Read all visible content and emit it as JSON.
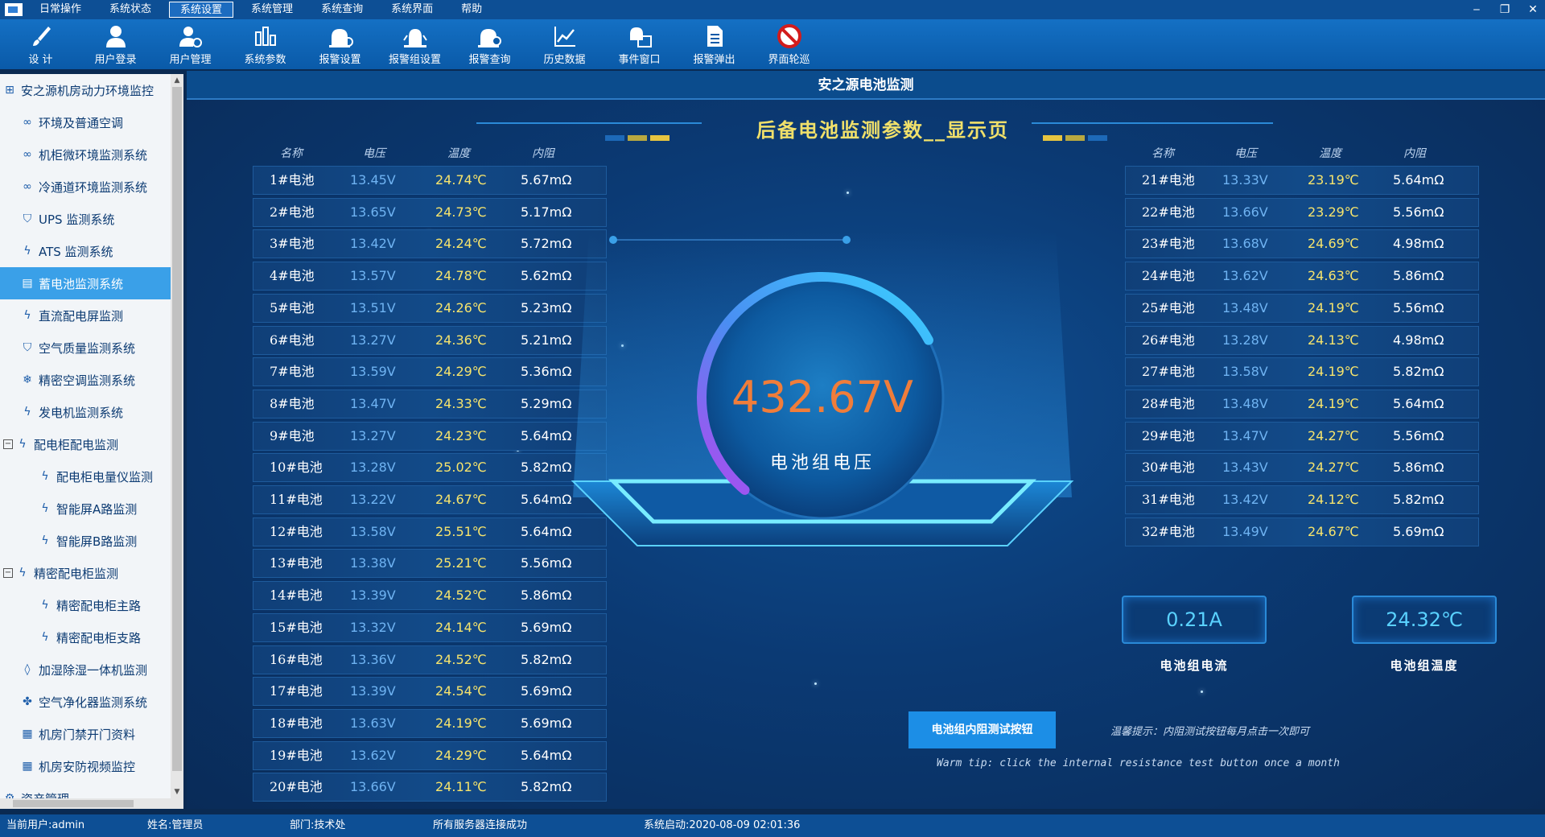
{
  "menubar": {
    "items": [
      "日常操作",
      "系统状态",
      "系统设置",
      "系统管理",
      "系统查询",
      "系统界面",
      "帮助"
    ],
    "active_index": 2,
    "window_controls": [
      "‒",
      "❐",
      "✕"
    ]
  },
  "toolbar": {
    "items": [
      {
        "label": "设 计",
        "icon": "brush-icon"
      },
      {
        "label": "用户登录",
        "icon": "user-icon"
      },
      {
        "label": "用户管理",
        "icon": "user-settings-icon"
      },
      {
        "label": "系统参数",
        "icon": "bar-chart-icon"
      },
      {
        "label": "报警设置",
        "icon": "alarm-settings-icon"
      },
      {
        "label": "报警组设置",
        "icon": "alarm-group-icon"
      },
      {
        "label": "报警查询",
        "icon": "alarm-search-icon"
      },
      {
        "label": "历史数据",
        "icon": "line-chart-icon"
      },
      {
        "label": "事件窗口",
        "icon": "event-window-icon"
      },
      {
        "label": "报警弹出",
        "icon": "document-icon"
      },
      {
        "label": "界面轮巡",
        "icon": "no-entry-icon"
      }
    ]
  },
  "sidebar": {
    "items": [
      {
        "label": "安之源机房动力环境监控",
        "icon": "grid-icon",
        "indent": 0,
        "expander": ""
      },
      {
        "label": "环境及普通空调",
        "icon": "link-icon",
        "indent": 1,
        "expander": ""
      },
      {
        "label": "机柜微环境监测系统",
        "icon": "link-icon",
        "indent": 1,
        "expander": ""
      },
      {
        "label": "冷通道环境监测系统",
        "icon": "link-icon",
        "indent": 1,
        "expander": ""
      },
      {
        "label": "UPS 监测系统",
        "icon": "shield-icon",
        "indent": 1,
        "expander": ""
      },
      {
        "label": "ATS 监测系统",
        "icon": "bolt-icon",
        "indent": 1,
        "expander": ""
      },
      {
        "label": "蓄电池监测系统",
        "icon": "battery-icon",
        "indent": 1,
        "expander": "",
        "selected": true
      },
      {
        "label": "直流配电屏监测",
        "icon": "bolt-icon",
        "indent": 1,
        "expander": ""
      },
      {
        "label": "空气质量监测系统",
        "icon": "shield-icon",
        "indent": 1,
        "expander": ""
      },
      {
        "label": "精密空调监测系统",
        "icon": "snowflake-icon",
        "indent": 1,
        "expander": ""
      },
      {
        "label": "发电机监测系统",
        "icon": "bolt-icon",
        "indent": 1,
        "expander": ""
      },
      {
        "label": "配电柜配电监测",
        "icon": "bolt-icon",
        "indent": 0,
        "expander": "−"
      },
      {
        "label": "配电柜电量仪监测",
        "icon": "bolt-icon",
        "indent": 2,
        "expander": ""
      },
      {
        "label": "智能屏A路监测",
        "icon": "bolt-icon",
        "indent": 2,
        "expander": ""
      },
      {
        "label": "智能屏B路监测",
        "icon": "bolt-icon",
        "indent": 2,
        "expander": ""
      },
      {
        "label": "精密配电柜监测",
        "icon": "bolt-icon",
        "indent": 0,
        "expander": "−"
      },
      {
        "label": "精密配电柜主路",
        "icon": "bolt-icon",
        "indent": 2,
        "expander": ""
      },
      {
        "label": "精密配电柜支路",
        "icon": "bolt-icon",
        "indent": 2,
        "expander": ""
      },
      {
        "label": "加湿除湿一体机监测",
        "icon": "droplet-icon",
        "indent": 1,
        "expander": ""
      },
      {
        "label": "空气净化器监测系统",
        "icon": "fan-icon",
        "indent": 1,
        "expander": ""
      },
      {
        "label": "机房门禁开门资料",
        "icon": "list-icon",
        "indent": 1,
        "expander": ""
      },
      {
        "label": "机房安防视频监控",
        "icon": "list-icon",
        "indent": 1,
        "expander": ""
      },
      {
        "label": "资产管理",
        "icon": "gear-icon",
        "indent": 0,
        "expander": ""
      }
    ]
  },
  "main": {
    "window_title": "安之源电池监测",
    "banner": "后备电池监测参数__显示页",
    "columns": [
      "名称",
      "电压",
      "温度",
      "内阻"
    ],
    "left_batteries": [
      [
        "1#电池",
        "13.45V",
        "24.74℃",
        "5.67mΩ"
      ],
      [
        "2#电池",
        "13.65V",
        "24.73℃",
        "5.17mΩ"
      ],
      [
        "3#电池",
        "13.42V",
        "24.24℃",
        "5.72mΩ"
      ],
      [
        "4#电池",
        "13.57V",
        "24.78℃",
        "5.62mΩ"
      ],
      [
        "5#电池",
        "13.51V",
        "24.26℃",
        "5.23mΩ"
      ],
      [
        "6#电池",
        "13.27V",
        "24.36℃",
        "5.21mΩ"
      ],
      [
        "7#电池",
        "13.59V",
        "24.29℃",
        "5.36mΩ"
      ],
      [
        "8#电池",
        "13.47V",
        "24.33℃",
        "5.29mΩ"
      ],
      [
        "9#电池",
        "13.27V",
        "24.23℃",
        "5.64mΩ"
      ],
      [
        "10#电池",
        "13.28V",
        "25.02℃",
        "5.82mΩ"
      ],
      [
        "11#电池",
        "13.22V",
        "24.67℃",
        "5.64mΩ"
      ],
      [
        "12#电池",
        "13.58V",
        "25.51℃",
        "5.64mΩ"
      ],
      [
        "13#电池",
        "13.38V",
        "25.21℃",
        "5.56mΩ"
      ],
      [
        "14#电池",
        "13.39V",
        "24.52℃",
        "5.86mΩ"
      ],
      [
        "15#电池",
        "13.32V",
        "24.14℃",
        "5.69mΩ"
      ],
      [
        "16#电池",
        "13.36V",
        "24.52℃",
        "5.82mΩ"
      ],
      [
        "17#电池",
        "13.39V",
        "24.54℃",
        "5.69mΩ"
      ],
      [
        "18#电池",
        "13.63V",
        "24.19℃",
        "5.69mΩ"
      ],
      [
        "19#电池",
        "13.62V",
        "24.29℃",
        "5.64mΩ"
      ],
      [
        "20#电池",
        "13.66V",
        "24.11℃",
        "5.82mΩ"
      ]
    ],
    "right_batteries": [
      [
        "21#电池",
        "13.33V",
        "23.19℃",
        "5.64mΩ"
      ],
      [
        "22#电池",
        "13.66V",
        "23.29℃",
        "5.56mΩ"
      ],
      [
        "23#电池",
        "13.68V",
        "24.69℃",
        "4.98mΩ"
      ],
      [
        "24#电池",
        "13.62V",
        "24.63℃",
        "5.86mΩ"
      ],
      [
        "25#电池",
        "13.48V",
        "24.19℃",
        "5.56mΩ"
      ],
      [
        "26#电池",
        "13.28V",
        "24.13℃",
        "4.98mΩ"
      ],
      [
        "27#电池",
        "13.58V",
        "24.19℃",
        "5.82mΩ"
      ],
      [
        "28#电池",
        "13.48V",
        "24.19℃",
        "5.64mΩ"
      ],
      [
        "29#电池",
        "13.47V",
        "24.27℃",
        "5.56mΩ"
      ],
      [
        "30#电池",
        "13.43V",
        "24.27℃",
        "5.86mΩ"
      ],
      [
        "31#电池",
        "13.42V",
        "24.12℃",
        "5.82mΩ"
      ],
      [
        "32#电池",
        "13.49V",
        "24.67℃",
        "5.69mΩ"
      ]
    ],
    "pack_voltage": "432.67V",
    "pack_voltage_label": "电池组电压",
    "gauge_fill_fraction": 0.72,
    "pack_current": "0.21A",
    "pack_current_label": "电池组电流",
    "pack_temperature": "24.32℃",
    "pack_temperature_label": "电池组温度",
    "test_button_label": "电池组内阻测试按钮",
    "tip_cn": "温馨提示：内阻测试按钮每月点击一次即可",
    "tip_en": "Warm tip: click the internal resistance test button once a month"
  },
  "statusbar": {
    "user": "当前用户:admin",
    "name": "姓名:管理员",
    "dept": "部门:技术处",
    "server": "所有服务器连接成功",
    "startup": "系统启动:2020-08-09 02:01:36"
  },
  "colors": {
    "voltage_value": "#f07d3a",
    "temperature_value": "#f7e46c",
    "cell_voltage": "#6fb3f2",
    "accent": "#1c8ee6"
  }
}
